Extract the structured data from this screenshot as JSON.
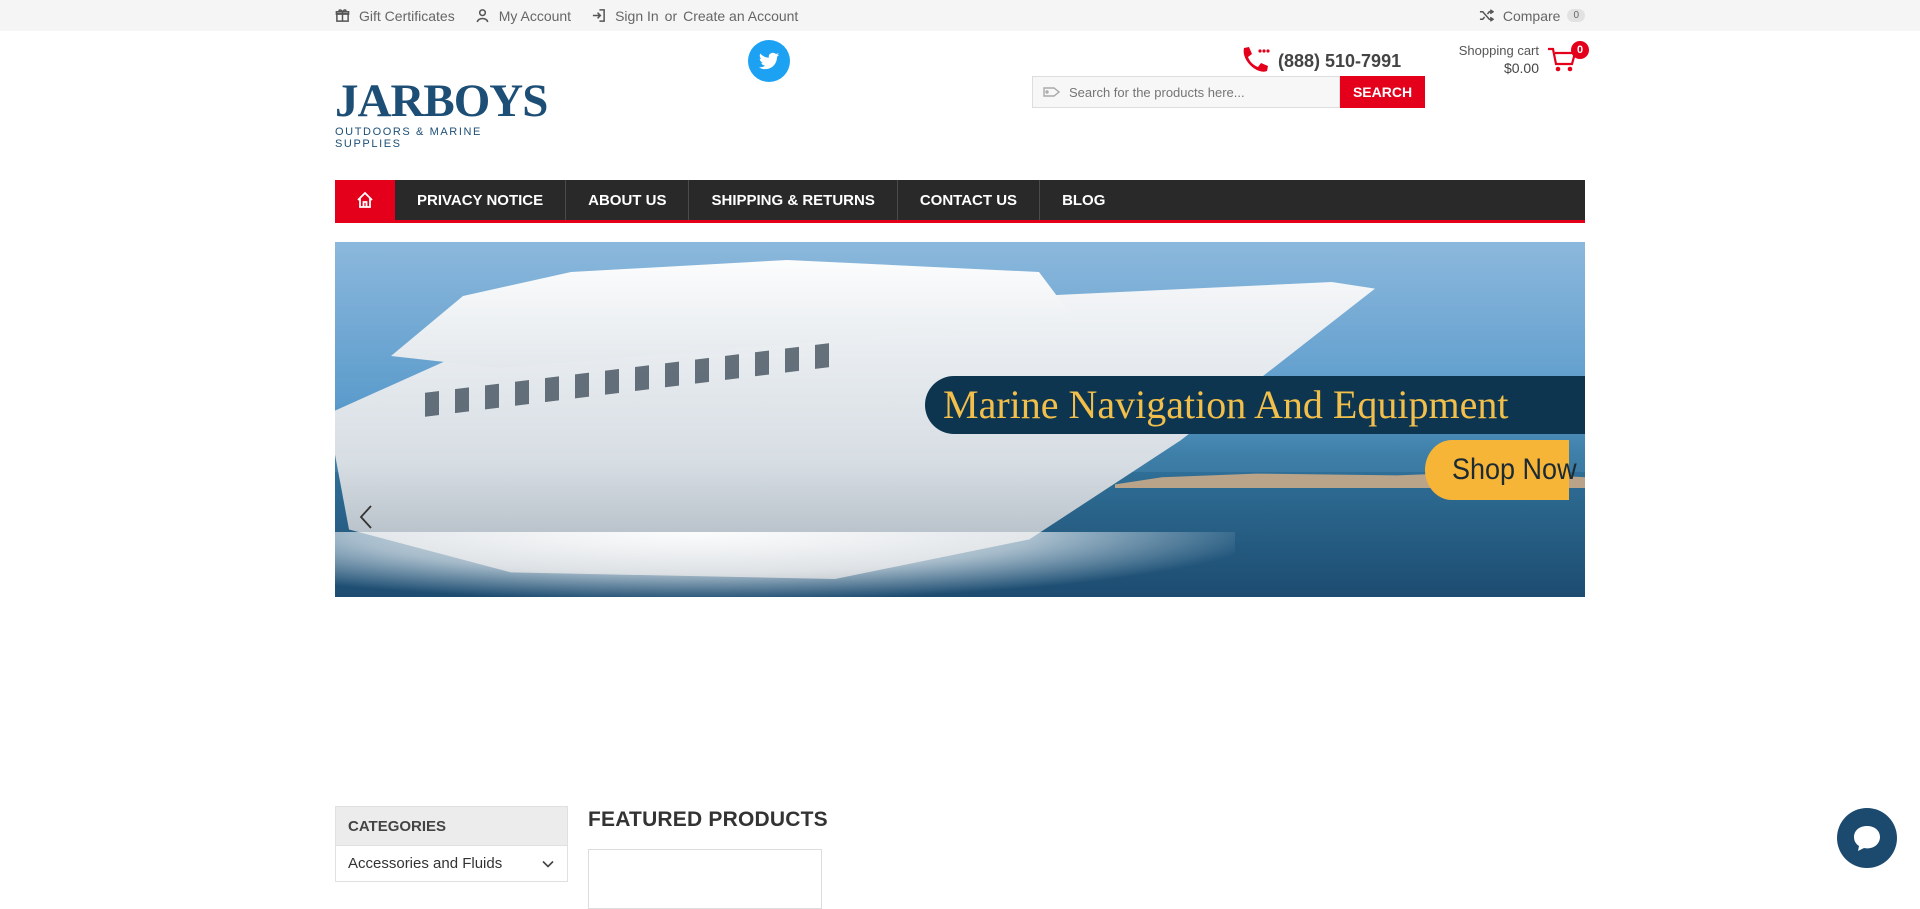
{
  "topbar": {
    "gift_certificates": "Gift Certificates",
    "my_account": "My Account",
    "sign_in": "Sign In",
    "or": "or",
    "create_account": "Create an Account",
    "compare": "Compare",
    "compare_count": "0"
  },
  "header": {
    "logo_main": "JARBOYS",
    "logo_sub": "OUTDOORS & MARINE SUPPLIES",
    "phone": "(888) 510-7991",
    "search_placeholder": "Search for the products here...",
    "search_button": "SEARCH",
    "cart_label": "Shopping cart",
    "cart_total": "$0.00",
    "cart_count": "0"
  },
  "nav": {
    "items": [
      {
        "label": "PRIVACY NOTICE"
      },
      {
        "label": "ABOUT US"
      },
      {
        "label": "SHIPPING & RETURNS"
      },
      {
        "label": "CONTACT US"
      },
      {
        "label": "BLOG"
      }
    ]
  },
  "banner": {
    "title": "Marine Navigation And Equipment",
    "button": "Shop Now"
  },
  "sidebar": {
    "heading": "CATEGORIES",
    "items": [
      {
        "label": "Accessories and Fluids"
      }
    ]
  },
  "main": {
    "featured_title": "FEATURED PRODUCTS"
  },
  "colors": {
    "accent": "#e4001b",
    "nav_bg": "#292929",
    "brand": "#1d4f76",
    "twitter": "#1da1f2"
  }
}
